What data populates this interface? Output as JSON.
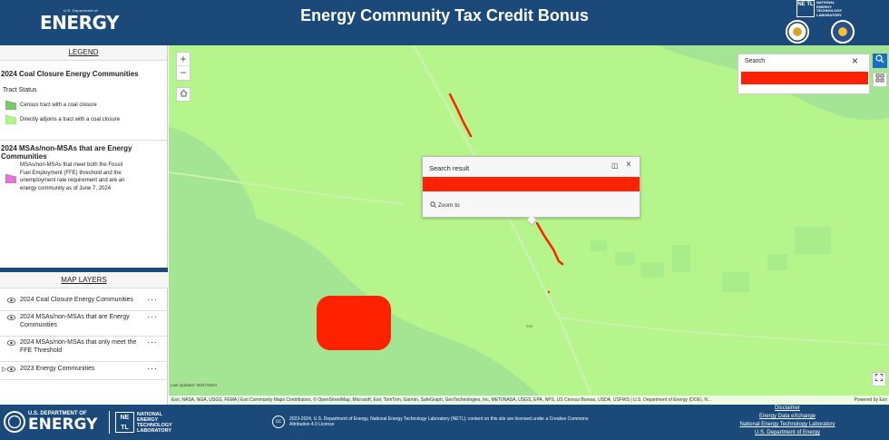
{
  "header": {
    "logo_small": "U.S. Department of",
    "logo_big": "ENERGY",
    "title": "Energy Community Tax Credit Bonus",
    "netl_box": "NE TL",
    "netl_text": [
      "NATIONAL",
      "ENERGY",
      "TECHNOLOGY",
      "LABORATORY"
    ]
  },
  "legend": {
    "heading": "LEGEND",
    "section1_title": "2024 Coal Closure Energy Communities",
    "tract_status": "Tract Status",
    "items1": [
      {
        "label": "Census tract with a coal closure",
        "color": "#7bc96f"
      },
      {
        "label": "Directly adjoins a tract with a coal closure",
        "color": "#b6f58c"
      }
    ],
    "section2_title": "2024 MSAs/non-MSAs that are Energy Communities",
    "items2": [
      {
        "label": "MSAs/non-MSAs that meet both the Fossil Fuel Employment (FFE) threshold and the unemployment rate requirement and are an energy community as of June 7, 2024",
        "color": "#e676d6"
      }
    ]
  },
  "layers": {
    "heading": "MAP LAYERS",
    "items": [
      {
        "label": "2024 Coal Closure Energy Communities"
      },
      {
        "label": "2024 MSAs/non-MSAs that are Energy Communities"
      },
      {
        "label": "2024 MSAs/non-MSAs that only meet the FFE Threshold"
      },
      {
        "label": "2023 Energy Communities"
      }
    ]
  },
  "map": {
    "search_title": "Search",
    "popup_title": "Search result",
    "popup_zoom": "Zoom to",
    "last_updated": "Last updated: 06/07/2024",
    "attribution": "Esri, NASA, NGA, USGS, FEMA | Esri Community Maps Contributors, © OpenStreetMap, Microsoft, Esri, TomTom, Garmin, SafeGraph, GeoTechnologies, Inc, METI/NASA, USGS, EPA, NPS, US Census Bureau, USDA, USFWS | U.S. Department of Energy (DOE), N...",
    "powered": "Powered by Esri",
    "road_label": "465",
    "colors": {
      "base": "#b6f58c",
      "coal_tract": "#a3e592",
      "redaction": "#ff2200"
    }
  },
  "footer": {
    "doe_small": "U.S. DEPARTMENT OF",
    "doe_big": "ENERGY",
    "netl_box": "NE TL",
    "netl_text": [
      "NATIONAL",
      "ENERGY",
      "TECHNOLOGY",
      "LABORATORY"
    ],
    "cc": "cc",
    "license": "2023-2024, U.S. Department of Energy, National Energy Technology Laboratory (NETL); content on this site are licensed under a Creative Commons Attribution 4.0 License",
    "links": [
      "Disclaimer",
      "Energy Data eXchange",
      "National Energy Technology Laboratory",
      "U.S. Department of Energy"
    ]
  }
}
